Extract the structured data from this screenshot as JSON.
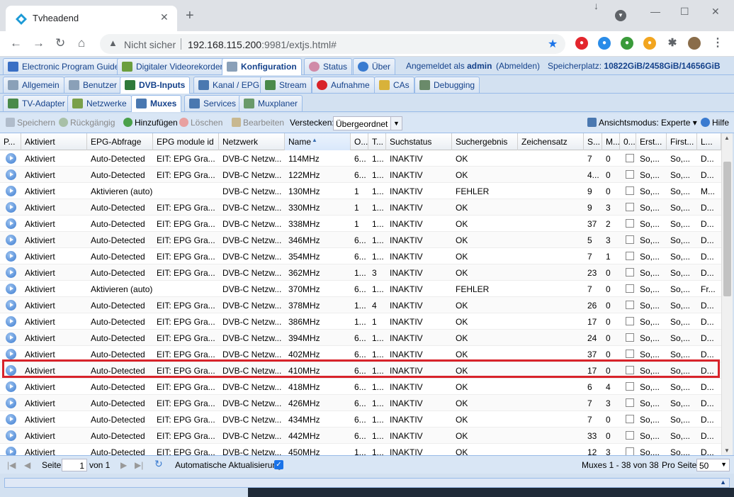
{
  "browser": {
    "tab_title": "Tvheadend",
    "security_label": "Nicht sicher",
    "url_host": "192.168.115.200",
    "url_rest": ":9981/extjs.html#"
  },
  "top_tabs": [
    "Electronic Program Guide",
    "Digitaler Videorekorder",
    "Konfiguration",
    "Status",
    "Über"
  ],
  "login": {
    "prefix": "Angemeldet als",
    "user": "admin",
    "logout": "(Abmelden)",
    "storage_label": "Speicherplatz:",
    "storage_value": "10822GiB/2458GiB/14656GiB"
  },
  "config_tabs": [
    "Allgemein",
    "Benutzer",
    "DVB-Inputs",
    "Kanal / EPG",
    "Stream",
    "Aufnahme",
    "CAs",
    "Debugging"
  ],
  "dvb_tabs": [
    "TV-Adapter",
    "Netzwerke",
    "Muxes",
    "Services",
    "Muxplaner"
  ],
  "grid_toolbar": {
    "save": "Speichern",
    "undo": "Rückgängig",
    "add": "Hinzufügen",
    "delete": "Löschen",
    "edit": "Bearbeiten",
    "hide_label": "Verstecken:",
    "hide_value": "Übergeordnet d",
    "view_mode": "Ansichtsmodus: Experte",
    "help": "Hilfe"
  },
  "columns": [
    "P...",
    "Aktiviert",
    "EPG-Abfrage",
    "EPG module id",
    "Netzwerk",
    "Name",
    "O...",
    "T...",
    "Suchstatus",
    "Suchergebnis",
    "Zeichensatz",
    "S...",
    "M...",
    "0...",
    "Erst...",
    "First...",
    "L..."
  ],
  "rows": [
    [
      "Aktiviert",
      "Auto-Detected",
      "EIT: EPG Gra...",
      "DVB-C Netzw...",
      "114MHz",
      "6...",
      "1...",
      "INAKTIV",
      "OK",
      "",
      "7",
      "0",
      "So,...",
      "So,...",
      "D..."
    ],
    [
      "Aktiviert",
      "Auto-Detected",
      "EIT: EPG Gra...",
      "DVB-C Netzw...",
      "122MHz",
      "6...",
      "1...",
      "INAKTIV",
      "OK",
      "",
      "4...",
      "0",
      "So,...",
      "So,...",
      "D..."
    ],
    [
      "Aktiviert",
      "Aktivieren (auto)",
      "",
      "DVB-C Netzw...",
      "130MHz",
      "1",
      "1...",
      "INAKTIV",
      "FEHLER",
      "",
      "9",
      "0",
      "So,...",
      "So,...",
      "M..."
    ],
    [
      "Aktiviert",
      "Auto-Detected",
      "EIT: EPG Gra...",
      "DVB-C Netzw...",
      "330MHz",
      "1",
      "1...",
      "INAKTIV",
      "OK",
      "",
      "9",
      "3",
      "So,...",
      "So,...",
      "D..."
    ],
    [
      "Aktiviert",
      "Auto-Detected",
      "EIT: EPG Gra...",
      "DVB-C Netzw...",
      "338MHz",
      "1",
      "1...",
      "INAKTIV",
      "OK",
      "",
      "37",
      "2",
      "So,...",
      "So,...",
      "D..."
    ],
    [
      "Aktiviert",
      "Auto-Detected",
      "EIT: EPG Gra...",
      "DVB-C Netzw...",
      "346MHz",
      "6...",
      "1...",
      "INAKTIV",
      "OK",
      "",
      "5",
      "3",
      "So,...",
      "So,...",
      "D..."
    ],
    [
      "Aktiviert",
      "Auto-Detected",
      "EIT: EPG Gra...",
      "DVB-C Netzw...",
      "354MHz",
      "6...",
      "1...",
      "INAKTIV",
      "OK",
      "",
      "7",
      "1",
      "So,...",
      "So,...",
      "D..."
    ],
    [
      "Aktiviert",
      "Auto-Detected",
      "EIT: EPG Gra...",
      "DVB-C Netzw...",
      "362MHz",
      "1...",
      "3",
      "INAKTIV",
      "OK",
      "",
      "23",
      "0",
      "So,...",
      "So,...",
      "D..."
    ],
    [
      "Aktiviert",
      "Aktivieren (auto)",
      "",
      "DVB-C Netzw...",
      "370MHz",
      "6...",
      "1...",
      "INAKTIV",
      "FEHLER",
      "",
      "7",
      "0",
      "So,...",
      "So,...",
      "Fr..."
    ],
    [
      "Aktiviert",
      "Auto-Detected",
      "EIT: EPG Gra...",
      "DVB-C Netzw...",
      "378MHz",
      "1...",
      "4",
      "INAKTIV",
      "OK",
      "",
      "26",
      "0",
      "So,...",
      "So,...",
      "D..."
    ],
    [
      "Aktiviert",
      "Auto-Detected",
      "EIT: EPG Gra...",
      "DVB-C Netzw...",
      "386MHz",
      "1...",
      "1",
      "INAKTIV",
      "OK",
      "",
      "17",
      "0",
      "So,...",
      "So,...",
      "D..."
    ],
    [
      "Aktiviert",
      "Auto-Detected",
      "EIT: EPG Gra...",
      "DVB-C Netzw...",
      "394MHz",
      "6...",
      "1...",
      "INAKTIV",
      "OK",
      "",
      "24",
      "0",
      "So,...",
      "So,...",
      "D..."
    ],
    [
      "Aktiviert",
      "Auto-Detected",
      "EIT: EPG Gra...",
      "DVB-C Netzw...",
      "402MHz",
      "6...",
      "1...",
      "INAKTIV",
      "OK",
      "",
      "37",
      "0",
      "So,...",
      "So,...",
      "D..."
    ],
    [
      "Aktiviert",
      "Auto-Detected",
      "EIT: EPG Gra...",
      "DVB-C Netzw...",
      "410MHz",
      "6...",
      "1...",
      "INAKTIV",
      "OK",
      "",
      "17",
      "0",
      "So,...",
      "So,...",
      "D..."
    ],
    [
      "Aktiviert",
      "Auto-Detected",
      "EIT: EPG Gra...",
      "DVB-C Netzw...",
      "418MHz",
      "6...",
      "1...",
      "INAKTIV",
      "OK",
      "",
      "6",
      "4",
      "So,...",
      "So,...",
      "D..."
    ],
    [
      "Aktiviert",
      "Auto-Detected",
      "EIT: EPG Gra...",
      "DVB-C Netzw...",
      "426MHz",
      "6...",
      "1...",
      "INAKTIV",
      "OK",
      "",
      "7",
      "3",
      "So,...",
      "So,...",
      "D..."
    ],
    [
      "Aktiviert",
      "Auto-Detected",
      "EIT: EPG Gra...",
      "DVB-C Netzw...",
      "434MHz",
      "6...",
      "1...",
      "INAKTIV",
      "OK",
      "",
      "7",
      "0",
      "So,...",
      "So,...",
      "D..."
    ],
    [
      "Aktiviert",
      "Auto-Detected",
      "EIT: EPG Gra...",
      "DVB-C Netzw...",
      "442MHz",
      "6...",
      "1...",
      "INAKTIV",
      "OK",
      "",
      "33",
      "0",
      "So,...",
      "So,...",
      "D..."
    ],
    [
      "Aktiviert",
      "Auto-Detected",
      "EIT: EPG Gra...",
      "DVB-C Netzw...",
      "450MHz",
      "1...",
      "1...",
      "INAKTIV",
      "OK",
      "",
      "12",
      "3",
      "So,...",
      "So,...",
      "D..."
    ]
  ],
  "highlighted_row": 13,
  "pager": {
    "page_label": "Seite",
    "page_value": "1",
    "of_label": "von 1",
    "auto_refresh": "Automatische Aktualisierung",
    "summary": "Muxes 1 - 38 von 38",
    "per_page_label": "Pro Seite",
    "per_page_value": "50"
  },
  "colors": {
    "accent": "#15428b",
    "highlight": "#d8232a",
    "panel": "#d3e1f1"
  }
}
